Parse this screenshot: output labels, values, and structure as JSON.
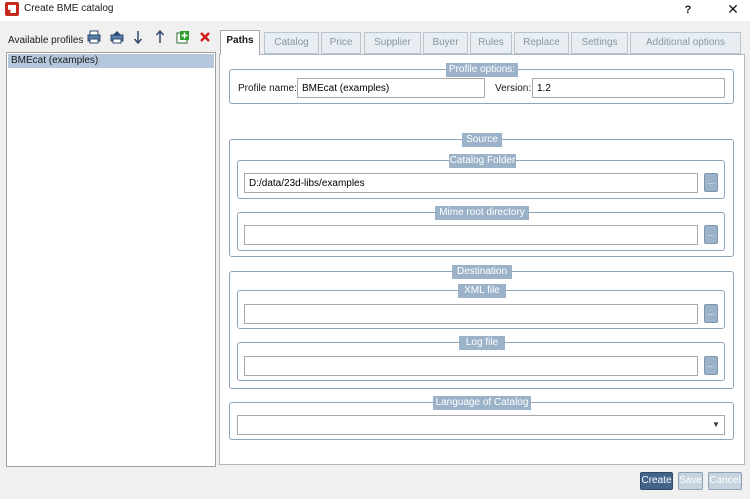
{
  "window": {
    "title": "Create BME catalog",
    "help_label": "?",
    "close_label": "✕"
  },
  "profiles": {
    "label": "Available profiles",
    "items": [
      "BMEcat (examples)"
    ]
  },
  "tabs": [
    "Paths",
    "Catalog",
    "Price",
    "Supplier",
    "Buyer",
    "Rules",
    "Replace",
    "Settings",
    "Additional options"
  ],
  "active_tab": "Paths",
  "profile_options": {
    "title": "Profile options:",
    "name_label": "Profile name:",
    "name_value": "BMEcat (examples)",
    "version_label": "Version:",
    "version_value": "1.2"
  },
  "source": {
    "title": "Source",
    "catalog_folder": {
      "title": "Catalog Folder",
      "value": "D:/data/23d-libs/examples"
    },
    "mime_root": {
      "title": "Mime root directory",
      "value": ""
    }
  },
  "destination": {
    "title": "Destination",
    "xml_file": {
      "title": "XML file",
      "value": ""
    },
    "log_file": {
      "title": "Log file",
      "value": ""
    }
  },
  "language": {
    "title": "Language of Catalog",
    "value": ""
  },
  "browse_label": "...",
  "buttons": {
    "create": "Create",
    "save": "Save",
    "cancel": "Cancel"
  }
}
